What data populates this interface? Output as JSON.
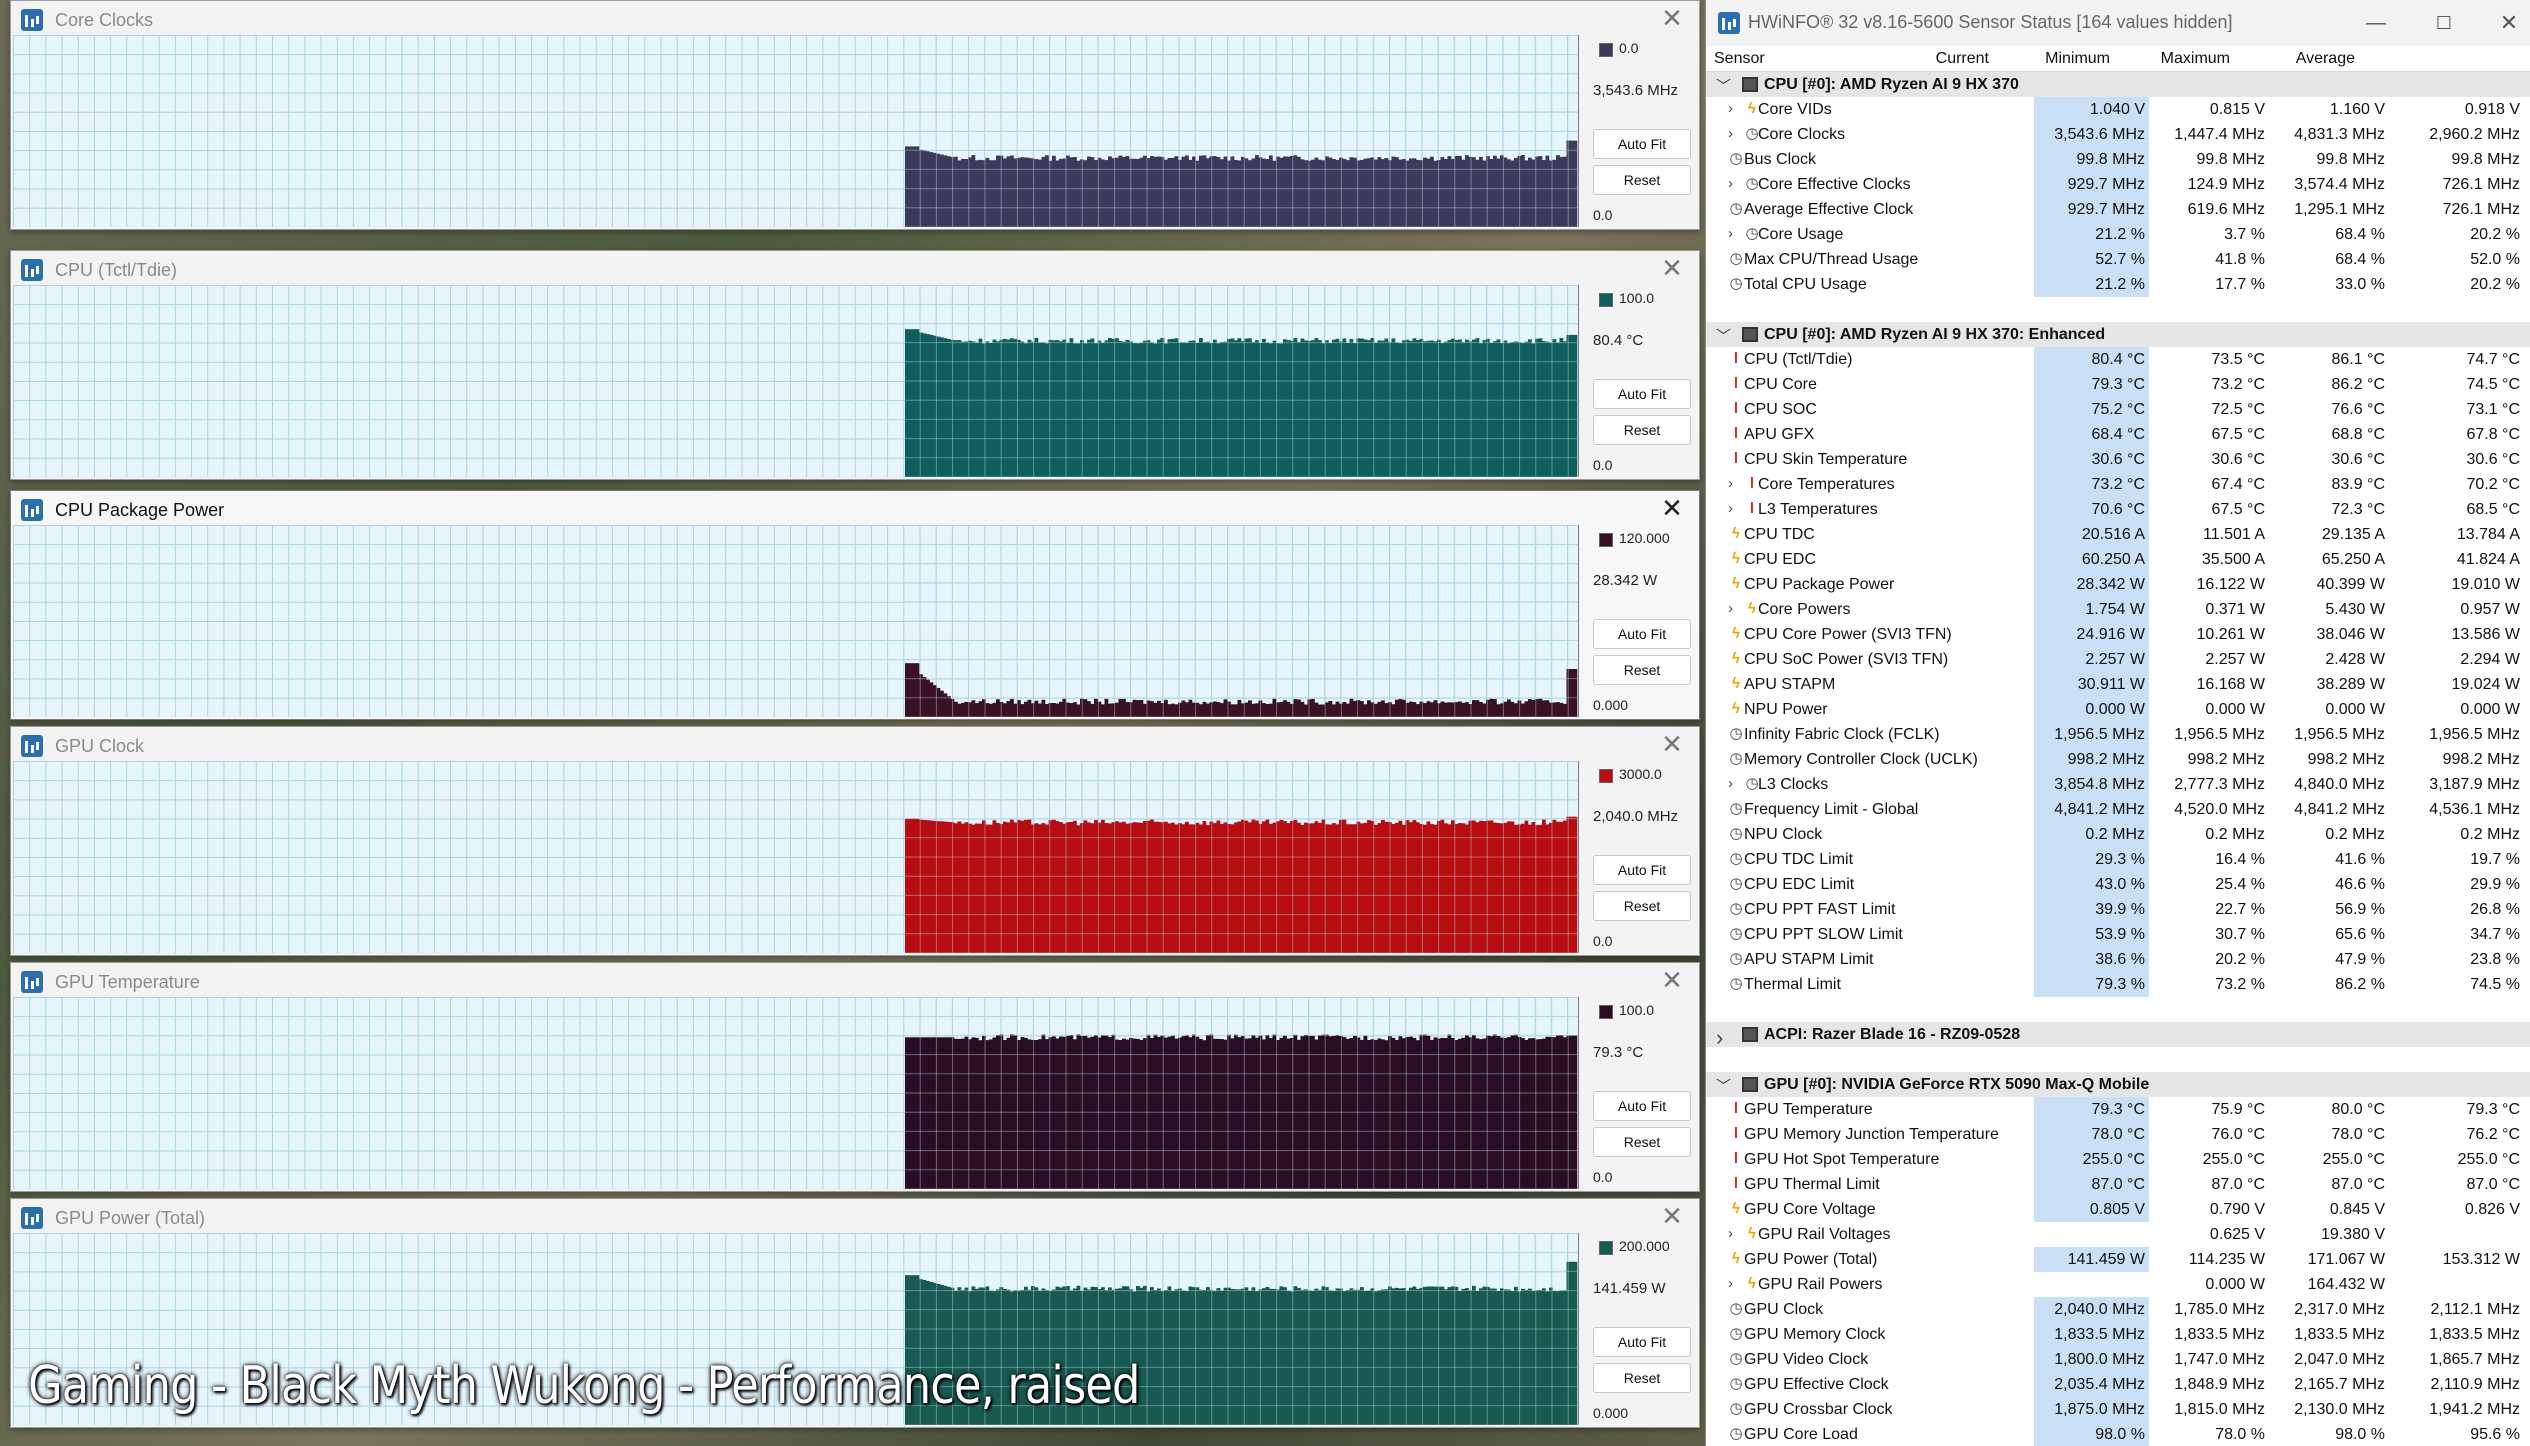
{
  "graphs": [
    {
      "title": "Core Clocks",
      "max": "0.0",
      "current": "3,543.6 MHz",
      "min": "0.0",
      "color": "#3c3a5a",
      "active": false,
      "level": 0.36,
      "spike": 0.45,
      "start_spike": 0.42
    },
    {
      "title": "CPU (Tctl/Tdie)",
      "max": "100.0",
      "current": "80.4 °C",
      "min": "0.0",
      "color": "#0f5e5c",
      "active": false,
      "level": 0.71,
      "spike": 0.74,
      "start_spike": 0.77
    },
    {
      "title": "CPU Package Power",
      "max": "120.000",
      "current": "28.342 W",
      "min": "0.000",
      "color": "#3a1024",
      "active": true,
      "level": 0.08,
      "spike": 0.25,
      "start_spike": 0.28
    },
    {
      "title": "GPU Clock",
      "max": "3000.0",
      "current": "2,040.0 MHz",
      "min": "0.0",
      "color": "#b80d10",
      "active": false,
      "level": 0.68,
      "spike": 0.71,
      "start_spike": 0.7
    },
    {
      "title": "GPU Temperature",
      "max": "100.0",
      "current": "79.3 °C",
      "min": "0.0",
      "color": "#2a0c24",
      "active": false,
      "level": 0.79,
      "spike": 0.8,
      "start_spike": 0.79
    },
    {
      "title": "GPU Power (Total)",
      "max": "200.000",
      "current": "141.459 W",
      "min": "0.000",
      "color": "#175a52",
      "active": false,
      "level": 0.71,
      "spike": 0.85,
      "start_spike": 0.78
    }
  ],
  "buttons": {
    "autofit": "Auto Fit",
    "reset": "Reset"
  },
  "caption": "Gaming - Black Myth Wukong - Performance, raised",
  "hwinfo": {
    "title": "HWiNFO® 32 v8.16-5600 Sensor Status [164 values hidden]",
    "columns": {
      "sensor": "Sensor",
      "current": "Current",
      "minimum": "Minimum",
      "maximum": "Maximum",
      "average": "Average"
    },
    "rows": [
      {
        "type": "group",
        "label": "CPU [#0]: AMD Ryzen AI 9 HX 370",
        "expanded": true
      },
      {
        "type": "item",
        "label": "Core VIDs",
        "icon": "volt",
        "sub": true,
        "cur": "1.040 V",
        "min": "0.815 V",
        "max": "1.160 V",
        "avg": "0.918 V"
      },
      {
        "type": "item",
        "label": "Core Clocks",
        "icon": "clock",
        "sub": true,
        "cur": "3,543.6 MHz",
        "min": "1,447.4 MHz",
        "max": "4,831.3 MHz",
        "avg": "2,960.2 MHz"
      },
      {
        "type": "item",
        "label": "Bus Clock",
        "icon": "clock",
        "cur": "99.8 MHz",
        "min": "99.8 MHz",
        "max": "99.8 MHz",
        "avg": "99.8 MHz"
      },
      {
        "type": "item",
        "label": "Core Effective Clocks",
        "icon": "clock",
        "sub": true,
        "cur": "929.7 MHz",
        "min": "124.9 MHz",
        "max": "3,574.4 MHz",
        "avg": "726.1 MHz"
      },
      {
        "type": "item",
        "label": "Average Effective Clock",
        "icon": "clock",
        "cur": "929.7 MHz",
        "min": "619.6 MHz",
        "max": "1,295.1 MHz",
        "avg": "726.1 MHz"
      },
      {
        "type": "item",
        "label": "Core Usage",
        "icon": "clock",
        "sub": true,
        "cur": "21.2 %",
        "min": "3.7 %",
        "max": "68.4 %",
        "avg": "20.2 %"
      },
      {
        "type": "item",
        "label": "Max CPU/Thread Usage",
        "icon": "clock",
        "cur": "52.7 %",
        "min": "41.8 %",
        "max": "68.4 %",
        "avg": "52.0 %"
      },
      {
        "type": "item",
        "label": "Total CPU Usage",
        "icon": "clock",
        "cur": "21.2 %",
        "min": "17.7 %",
        "max": "33.0 %",
        "avg": "20.2 %"
      },
      {
        "type": "spacer"
      },
      {
        "type": "group",
        "label": "CPU [#0]: AMD Ryzen AI 9 HX 370: Enhanced",
        "expanded": true
      },
      {
        "type": "item",
        "label": "CPU (Tctl/Tdie)",
        "icon": "temp",
        "cur": "80.4 °C",
        "min": "73.5 °C",
        "max": "86.1 °C",
        "avg": "74.7 °C"
      },
      {
        "type": "item",
        "label": "CPU Core",
        "icon": "temp",
        "cur": "79.3 °C",
        "min": "73.2 °C",
        "max": "86.2 °C",
        "avg": "74.5 °C"
      },
      {
        "type": "item",
        "label": "CPU SOC",
        "icon": "temp",
        "cur": "75.2 °C",
        "min": "72.5 °C",
        "max": "76.6 °C",
        "avg": "73.1 °C"
      },
      {
        "type": "item",
        "label": "APU GFX",
        "icon": "temp",
        "cur": "68.4 °C",
        "min": "67.5 °C",
        "max": "68.8 °C",
        "avg": "67.8 °C"
      },
      {
        "type": "item",
        "label": "CPU Skin Temperature",
        "icon": "temp",
        "cur": "30.6 °C",
        "min": "30.6 °C",
        "max": "30.6 °C",
        "avg": "30.6 °C"
      },
      {
        "type": "item",
        "label": "Core Temperatures",
        "icon": "temp",
        "sub": true,
        "cur": "73.2 °C",
        "min": "67.4 °C",
        "max": "83.9 °C",
        "avg": "70.2 °C"
      },
      {
        "type": "item",
        "label": "L3 Temperatures",
        "icon": "temp",
        "sub": true,
        "cur": "70.6 °C",
        "min": "67.5 °C",
        "max": "72.3 °C",
        "avg": "68.5 °C"
      },
      {
        "type": "item",
        "label": "CPU TDC",
        "icon": "volt",
        "cur": "20.516 A",
        "min": "11.501 A",
        "max": "29.135 A",
        "avg": "13.784 A"
      },
      {
        "type": "item",
        "label": "CPU EDC",
        "icon": "volt",
        "cur": "60.250 A",
        "min": "35.500 A",
        "max": "65.250 A",
        "avg": "41.824 A"
      },
      {
        "type": "item",
        "label": "CPU Package Power",
        "icon": "volt",
        "cur": "28.342 W",
        "min": "16.122 W",
        "max": "40.399 W",
        "avg": "19.010 W"
      },
      {
        "type": "item",
        "label": "Core Powers",
        "icon": "volt",
        "sub": true,
        "cur": "1.754 W",
        "min": "0.371 W",
        "max": "5.430 W",
        "avg": "0.957 W"
      },
      {
        "type": "item",
        "label": "CPU Core Power (SVI3 TFN)",
        "icon": "volt",
        "cur": "24.916 W",
        "min": "10.261 W",
        "max": "38.046 W",
        "avg": "13.586 W"
      },
      {
        "type": "item",
        "label": "CPU SoC Power (SVI3 TFN)",
        "icon": "volt",
        "cur": "2.257 W",
        "min": "2.257 W",
        "max": "2.428 W",
        "avg": "2.294 W"
      },
      {
        "type": "item",
        "label": "APU STAPM",
        "icon": "volt",
        "cur": "30.911 W",
        "min": "16.168 W",
        "max": "38.289 W",
        "avg": "19.024 W"
      },
      {
        "type": "item",
        "label": "NPU Power",
        "icon": "volt",
        "cur": "0.000 W",
        "min": "0.000 W",
        "max": "0.000 W",
        "avg": "0.000 W"
      },
      {
        "type": "item",
        "label": "Infinity Fabric Clock (FCLK)",
        "icon": "clock",
        "cur": "1,956.5 MHz",
        "min": "1,956.5 MHz",
        "max": "1,956.5 MHz",
        "avg": "1,956.5 MHz"
      },
      {
        "type": "item",
        "label": "Memory Controller Clock (UCLK)",
        "icon": "clock",
        "cur": "998.2 MHz",
        "min": "998.2 MHz",
        "max": "998.2 MHz",
        "avg": "998.2 MHz"
      },
      {
        "type": "item",
        "label": "L3 Clocks",
        "icon": "clock",
        "sub": true,
        "cur": "3,854.8 MHz",
        "min": "2,777.3 MHz",
        "max": "4,840.0 MHz",
        "avg": "3,187.9 MHz"
      },
      {
        "type": "item",
        "label": "Frequency Limit - Global",
        "icon": "clock",
        "cur": "4,841.2 MHz",
        "min": "4,520.0 MHz",
        "max": "4,841.2 MHz",
        "avg": "4,536.1 MHz"
      },
      {
        "type": "item",
        "label": "NPU Clock",
        "icon": "clock",
        "cur": "0.2 MHz",
        "min": "0.2 MHz",
        "max": "0.2 MHz",
        "avg": "0.2 MHz"
      },
      {
        "type": "item",
        "label": "CPU TDC Limit",
        "icon": "clock",
        "cur": "29.3 %",
        "min": "16.4 %",
        "max": "41.6 %",
        "avg": "19.7 %"
      },
      {
        "type": "item",
        "label": "CPU EDC Limit",
        "icon": "clock",
        "cur": "43.0 %",
        "min": "25.4 %",
        "max": "46.6 %",
        "avg": "29.9 %"
      },
      {
        "type": "item",
        "label": "CPU PPT FAST Limit",
        "icon": "clock",
        "cur": "39.9 %",
        "min": "22.7 %",
        "max": "56.9 %",
        "avg": "26.8 %"
      },
      {
        "type": "item",
        "label": "CPU PPT SLOW Limit",
        "icon": "clock",
        "cur": "53.9 %",
        "min": "30.7 %",
        "max": "65.6 %",
        "avg": "34.7 %"
      },
      {
        "type": "item",
        "label": "APU STAPM Limit",
        "icon": "clock",
        "cur": "38.6 %",
        "min": "20.2 %",
        "max": "47.9 %",
        "avg": "23.8 %"
      },
      {
        "type": "item",
        "label": "Thermal Limit",
        "icon": "clock",
        "cur": "79.3 %",
        "min": "73.2 %",
        "max": "86.2 %",
        "avg": "74.5 %"
      },
      {
        "type": "spacer"
      },
      {
        "type": "group",
        "label": "ACPI: Razer Blade 16 - RZ09-0528",
        "expanded": false
      },
      {
        "type": "spacer"
      },
      {
        "type": "group",
        "label": "GPU [#0]: NVIDIA  GeForce RTX 5090 Max-Q Mobile",
        "expanded": true
      },
      {
        "type": "item",
        "label": "GPU Temperature",
        "icon": "temp",
        "cur": "79.3 °C",
        "min": "75.9 °C",
        "max": "80.0 °C",
        "avg": "79.3 °C"
      },
      {
        "type": "item",
        "label": "GPU Memory Junction Temperature",
        "icon": "temp",
        "cur": "78.0 °C",
        "min": "76.0 °C",
        "max": "78.0 °C",
        "avg": "76.2 °C"
      },
      {
        "type": "item",
        "label": "GPU Hot Spot Temperature",
        "icon": "temp",
        "cur": "255.0 °C",
        "min": "255.0 °C",
        "max": "255.0 °C",
        "avg": "255.0 °C"
      },
      {
        "type": "item",
        "label": "GPU Thermal Limit",
        "icon": "temp",
        "cur": "87.0 °C",
        "min": "87.0 °C",
        "max": "87.0 °C",
        "avg": "87.0 °C"
      },
      {
        "type": "item",
        "label": "GPU Core Voltage",
        "icon": "volt",
        "cur": "0.805 V",
        "min": "0.790 V",
        "max": "0.845 V",
        "avg": "0.826 V"
      },
      {
        "type": "item",
        "label": "GPU Rail Voltages",
        "icon": "volt",
        "sub": true,
        "cur": "",
        "min": "0.625 V",
        "max": "19.380 V",
        "avg": ""
      },
      {
        "type": "item",
        "label": "GPU Power (Total)",
        "icon": "volt",
        "cur": "141.459 W",
        "min": "114.235 W",
        "max": "171.067 W",
        "avg": "153.312 W"
      },
      {
        "type": "item",
        "label": "GPU Rail Powers",
        "icon": "volt",
        "sub": true,
        "cur": "",
        "min": "0.000 W",
        "max": "164.432 W",
        "avg": ""
      },
      {
        "type": "item",
        "label": "GPU Clock",
        "icon": "clock",
        "cur": "2,040.0 MHz",
        "min": "1,785.0 MHz",
        "max": "2,317.0 MHz",
        "avg": "2,112.1 MHz"
      },
      {
        "type": "item",
        "label": "GPU Memory Clock",
        "icon": "clock",
        "cur": "1,833.5 MHz",
        "min": "1,833.5 MHz",
        "max": "1,833.5 MHz",
        "avg": "1,833.5 MHz"
      },
      {
        "type": "item",
        "label": "GPU Video Clock",
        "icon": "clock",
        "cur": "1,800.0 MHz",
        "min": "1,747.0 MHz",
        "max": "2,047.0 MHz",
        "avg": "1,865.7 MHz"
      },
      {
        "type": "item",
        "label": "GPU Effective Clock",
        "icon": "clock",
        "cur": "2,035.4 MHz",
        "min": "1,848.9 MHz",
        "max": "2,165.7 MHz",
        "avg": "2,110.9 MHz"
      },
      {
        "type": "item",
        "label": "GPU Crossbar Clock",
        "icon": "clock",
        "cur": "1,875.0 MHz",
        "min": "1,815.0 MHz",
        "max": "2,130.0 MHz",
        "avg": "1,941.2 MHz"
      },
      {
        "type": "item",
        "label": "GPU Core Load",
        "icon": "clock",
        "cur": "98.0 %",
        "min": "78.0 %",
        "max": "98.0 %",
        "avg": "95.6 %"
      }
    ]
  }
}
